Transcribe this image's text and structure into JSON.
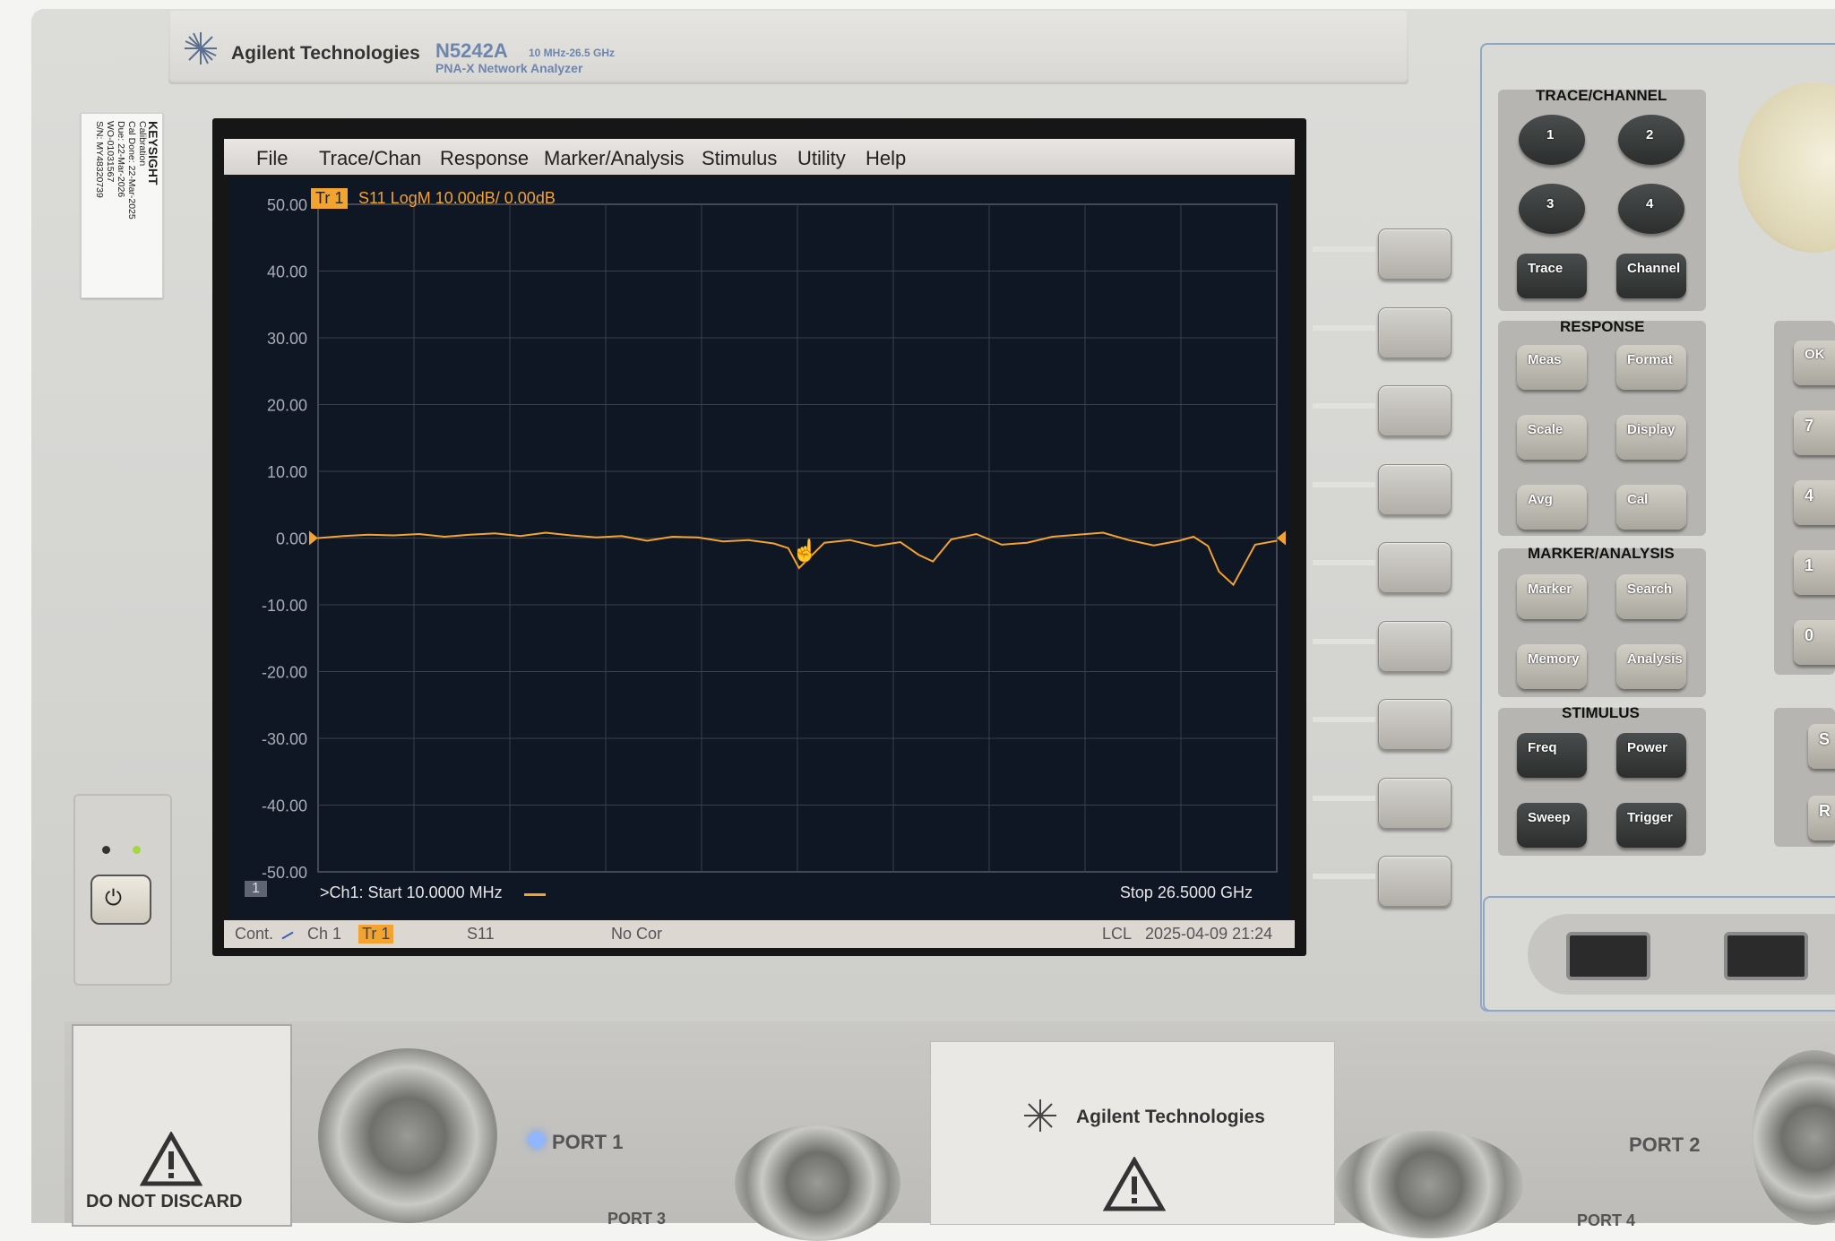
{
  "instrument": {
    "brand": "Agilent Technologies",
    "model": "N5242A",
    "range": "10 MHz-26.5 GHz",
    "subtitle": "PNA-X Network Analyzer"
  },
  "sticker": {
    "company": "KEYSIGHT",
    "heading": "Calibration",
    "cal_done_label": "Cal Done:",
    "cal_done": "22-Mar-2025",
    "due_label": "Due:",
    "due": "22-Mar-2026",
    "wo": "WO-01031567",
    "sn": "S/N: MY48320739"
  },
  "menu": [
    "File",
    "Trace/Chan",
    "Response",
    "Marker/Analysis",
    "Stimulus",
    "Utility",
    "Help"
  ],
  "trace_header": {
    "badge": "Tr 1",
    "text": "S11 LogM 10.00dB/  0.00dB"
  },
  "channel_footer": {
    "channel_num": "1",
    "start": ">Ch1:  Start  10.0000 MHz",
    "stop": "Stop  26.5000 GHz"
  },
  "status": {
    "mode": "Cont.",
    "channel": "Ch 1",
    "trace": "Tr 1",
    "param": "S11",
    "correction": "No Cor",
    "lcl": "LCL",
    "datetime": "2025-04-09 21:24"
  },
  "chart_data": {
    "type": "line",
    "title": "S11 LogM 10.00dB/  0.00dB",
    "xlabel": "",
    "ylabel": "",
    "ylim": [
      -50,
      50
    ],
    "xlim": [
      0.01,
      26.5
    ],
    "yticks": [
      "50.00",
      "40.00",
      "30.00",
      "20.00",
      "10.00",
      "0.00",
      "-10.00",
      "-20.00",
      "-30.00",
      "-40.00",
      "-50.00"
    ],
    "grid": true,
    "color": "#f2a330",
    "series": [
      {
        "x": [
          0.01,
          0.7,
          1.4,
          2.1,
          2.8,
          3.5,
          4.2,
          4.9,
          5.6,
          6.3,
          7.0,
          7.7,
          8.4,
          9.1,
          9.8,
          10.5,
          11.2,
          11.9,
          12.6,
          13.0,
          13.3,
          14.0,
          14.7,
          15.4,
          16.1,
          16.6,
          17.0,
          17.5,
          18.2,
          18.9,
          19.6,
          20.3,
          21.0,
          21.7,
          22.4,
          23.1,
          23.8,
          24.2,
          24.6,
          24.9,
          25.3,
          25.9,
          26.5
        ],
        "y": [
          0.0,
          0.3,
          0.5,
          0.4,
          0.6,
          0.2,
          0.5,
          0.7,
          0.3,
          0.8,
          0.4,
          0.1,
          0.3,
          -0.4,
          0.2,
          0.1,
          -0.5,
          -0.3,
          -0.8,
          -1.5,
          -4.5,
          -0.7,
          -0.3,
          -1.2,
          -0.6,
          -2.5,
          -3.5,
          -0.2,
          0.6,
          -1.0,
          -0.7,
          0.2,
          0.5,
          0.8,
          -0.3,
          -1.1,
          -0.4,
          0.2,
          -1.2,
          -5.0,
          -7.0,
          -1.0,
          -0.4
        ]
      }
    ]
  },
  "panel": {
    "groups": [
      "TRACE/CHANNEL",
      "RESPONSE",
      "MARKER/ANALYSIS",
      "STIMULUS"
    ],
    "trace_keys": [
      "1",
      "2",
      "3",
      "4",
      "Trace",
      "Channel"
    ],
    "response_keys": [
      "Meas",
      "Format",
      "Scale",
      "Display",
      "Avg",
      "Cal"
    ],
    "marker_keys": [
      "Marker",
      "Search",
      "Memory",
      "Analysis"
    ],
    "stimulus_keys": [
      "Freq",
      "Power",
      "Sweep",
      "Trigger"
    ],
    "num_keys": [
      "OK",
      "7",
      "4",
      "1",
      "0",
      "S",
      "R"
    ]
  },
  "front": {
    "warning": "DO NOT DISCARD",
    "port1": "PORT 1",
    "port2": "PORT 2",
    "port3": "PORT 3",
    "port4": "PORT 4",
    "brand2": "Agilent Technologies"
  }
}
